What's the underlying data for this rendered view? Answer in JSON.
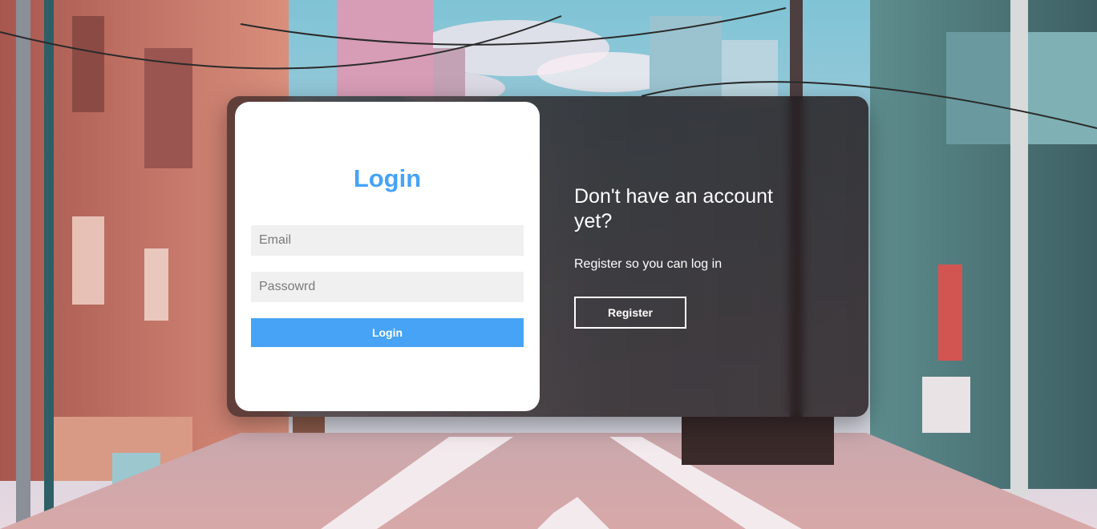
{
  "background": {
    "scene": "anime-street-illustration"
  },
  "login": {
    "title": "Login",
    "email_placeholder": "Email",
    "password_placeholder": "Passowrd",
    "button_label": "Login",
    "accent_color": "#46a3f5"
  },
  "register": {
    "title": "Don't have an account yet?",
    "subtitle": "Register so you can log in",
    "button_label": "Register"
  }
}
